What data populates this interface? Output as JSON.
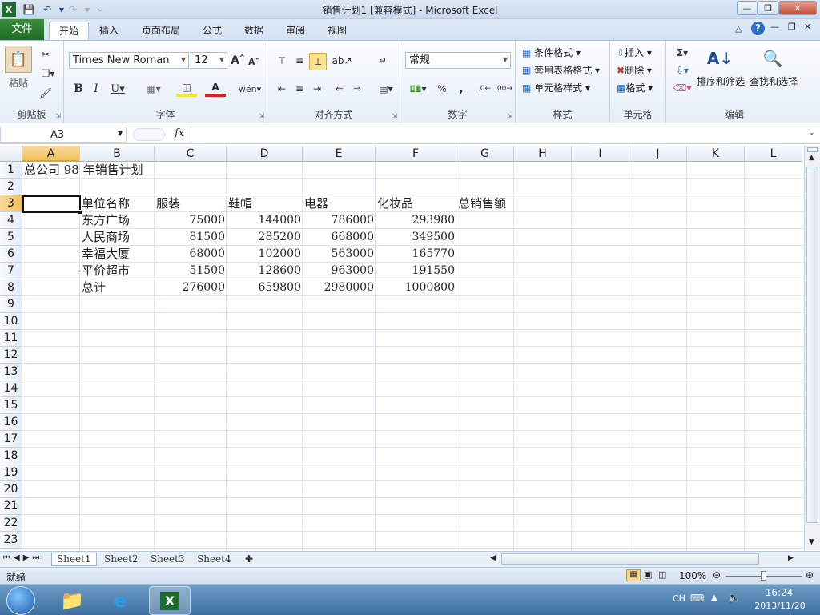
{
  "window": {
    "title": "销售计划1 [兼容模式] - Microsoft Excel"
  },
  "tabs": [
    {
      "label": "文件"
    },
    {
      "label": "开始"
    },
    {
      "label": "插入"
    },
    {
      "label": "页面布局"
    },
    {
      "label": "公式"
    },
    {
      "label": "数据"
    },
    {
      "label": "审阅"
    },
    {
      "label": "视图"
    }
  ],
  "ribbon": {
    "clipboard": {
      "group": "剪贴板",
      "paste": "粘贴"
    },
    "font": {
      "group": "字体",
      "name": "Times New Roman",
      "size": "12"
    },
    "alignment": {
      "group": "对齐方式"
    },
    "number": {
      "group": "数字",
      "format": "常规"
    },
    "styles": {
      "group": "样式",
      "cond": "条件格式",
      "table": "套用表格格式",
      "cell": "单元格样式"
    },
    "cells": {
      "group": "单元格",
      "insert": "插入",
      "delete": "删除",
      "format": "格式"
    },
    "editing": {
      "group": "编辑",
      "sort": "排序和筛选",
      "find": "查找和选择"
    }
  },
  "formula_bar": {
    "name_box": "A3",
    "fx": "fx",
    "value": ""
  },
  "columns": [
    "A",
    "B",
    "C",
    "D",
    "E",
    "F",
    "G",
    "H",
    "I",
    "J",
    "K",
    "L"
  ],
  "rows": [
    "1",
    "2",
    "3",
    "4",
    "5",
    "6",
    "7",
    "8",
    "9",
    "10",
    "11",
    "12",
    "13",
    "14",
    "15",
    "16",
    "17",
    "18",
    "19",
    "20",
    "21",
    "22",
    "23"
  ],
  "cells": {
    "A1": "总公司 98 年销售计划",
    "B3": "单位名称",
    "C3": "服装",
    "D3": "鞋帽",
    "E3": "电器",
    "F3": "化妆品",
    "G3": "总销售额",
    "B4": "东方广场",
    "C4": "75000",
    "D4": "144000",
    "E4": "786000",
    "F4": "293980",
    "B5": "人民商场",
    "C5": "81500",
    "D5": "285200",
    "E5": "668000",
    "F5": "349500",
    "B6": "幸福大厦",
    "C6": "68000",
    "D6": "102000",
    "E6": "563000",
    "F6": "165770",
    "B7": "平价超市",
    "C7": "51500",
    "D7": "128600",
    "E7": "963000",
    "F7": "191550",
    "B8": "总计",
    "C8": "276000",
    "D8": "659800",
    "E8": "2980000",
    "F8": "1000800"
  },
  "sheets": [
    "Sheet1",
    "Sheet2",
    "Sheet3",
    "Sheet4"
  ],
  "status": {
    "ready": "就绪",
    "zoom": "100%"
  },
  "taskbar": {
    "lang": "CH",
    "time": "16:24",
    "date": "2013/11/20"
  }
}
